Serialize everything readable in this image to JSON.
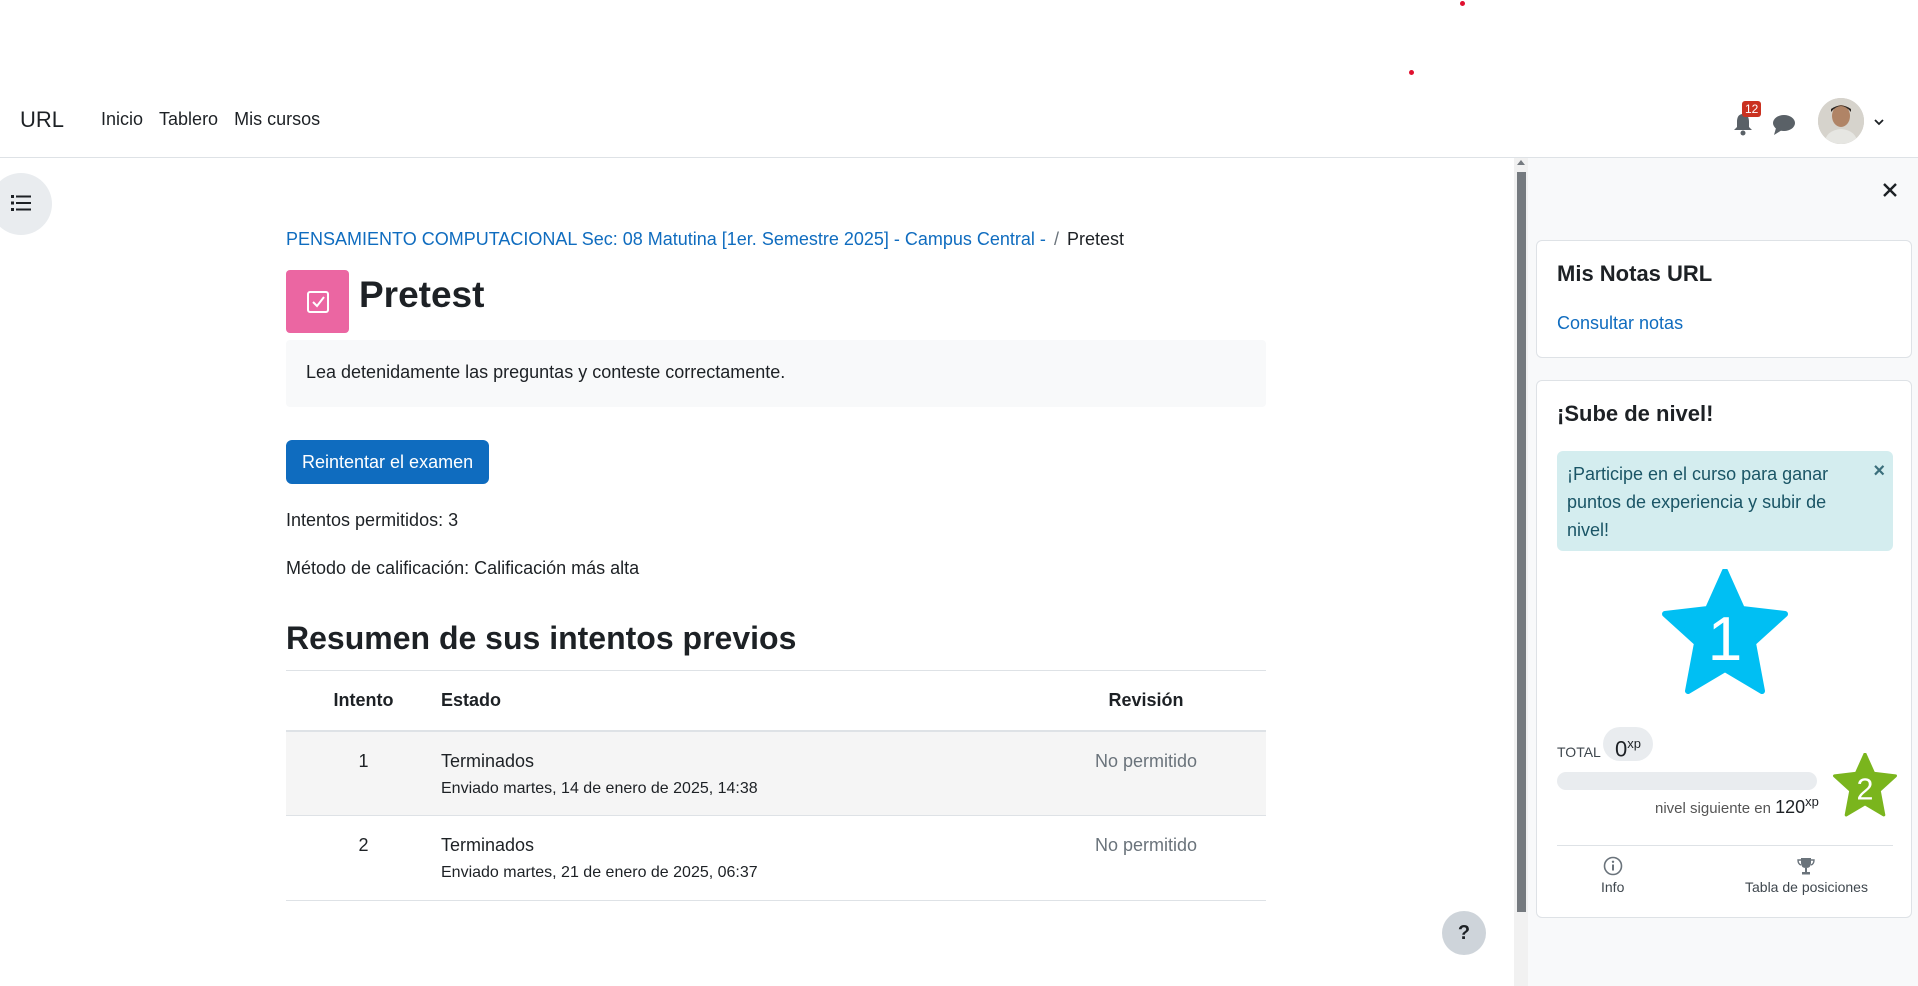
{
  "navbar": {
    "brand": "URL",
    "links": [
      "Inicio",
      "Tablero",
      "Mis cursos"
    ],
    "notification_count": "12"
  },
  "breadcrumb": {
    "course": "PENSAMIENTO COMPUTACIONAL Sec: 08 Matutina [1er. Semestre 2025] - Campus Central -",
    "separator": "/",
    "current": "Pretest"
  },
  "page": {
    "title": "Pretest",
    "intro": "Lea detenidamente las preguntas y conteste correctamente.",
    "retry_button": "Reintentar el examen",
    "attempts_allowed": "Intentos permitidos: 3",
    "grading_method": "Método de calificación: Calificación más alta",
    "summary_title": "Resumen de sus intentos previos"
  },
  "table": {
    "headers": [
      "Intento",
      "Estado",
      "Revisión"
    ],
    "rows": [
      {
        "attempt": "1",
        "status": "Terminados",
        "submitted": "Enviado martes, 14 de enero de 2025, 14:38",
        "review": "No permitido"
      },
      {
        "attempt": "2",
        "status": "Terminados",
        "submitted": "Enviado martes, 21 de enero de 2025, 06:37",
        "review": "No permitido"
      }
    ]
  },
  "help_button": "?",
  "drawer": {
    "notes_block": {
      "title": "Mis Notas URL",
      "link": "Consultar notas"
    },
    "level_block": {
      "title": "¡Sube de nivel!",
      "alert": "¡Participe en el curso para ganar puntos de experiencia y subir de nivel!",
      "alert_close": "×",
      "current_level": "1",
      "total_label": "TOTAL",
      "total_xp": "0",
      "xp_unit": "xp",
      "progress": 0,
      "next_level_text": "nivel siguiente en",
      "next_level_xp": "120",
      "next_level": "2",
      "footer": {
        "info": "Info",
        "leaderboard": "Tabla de posiciones"
      }
    }
  },
  "colors": {
    "primary": "#0f6cbf",
    "activity_icon": "#eb66a2",
    "level_star": "#00bff3",
    "next_star": "#7ab51d",
    "badge": "#ca3120"
  }
}
